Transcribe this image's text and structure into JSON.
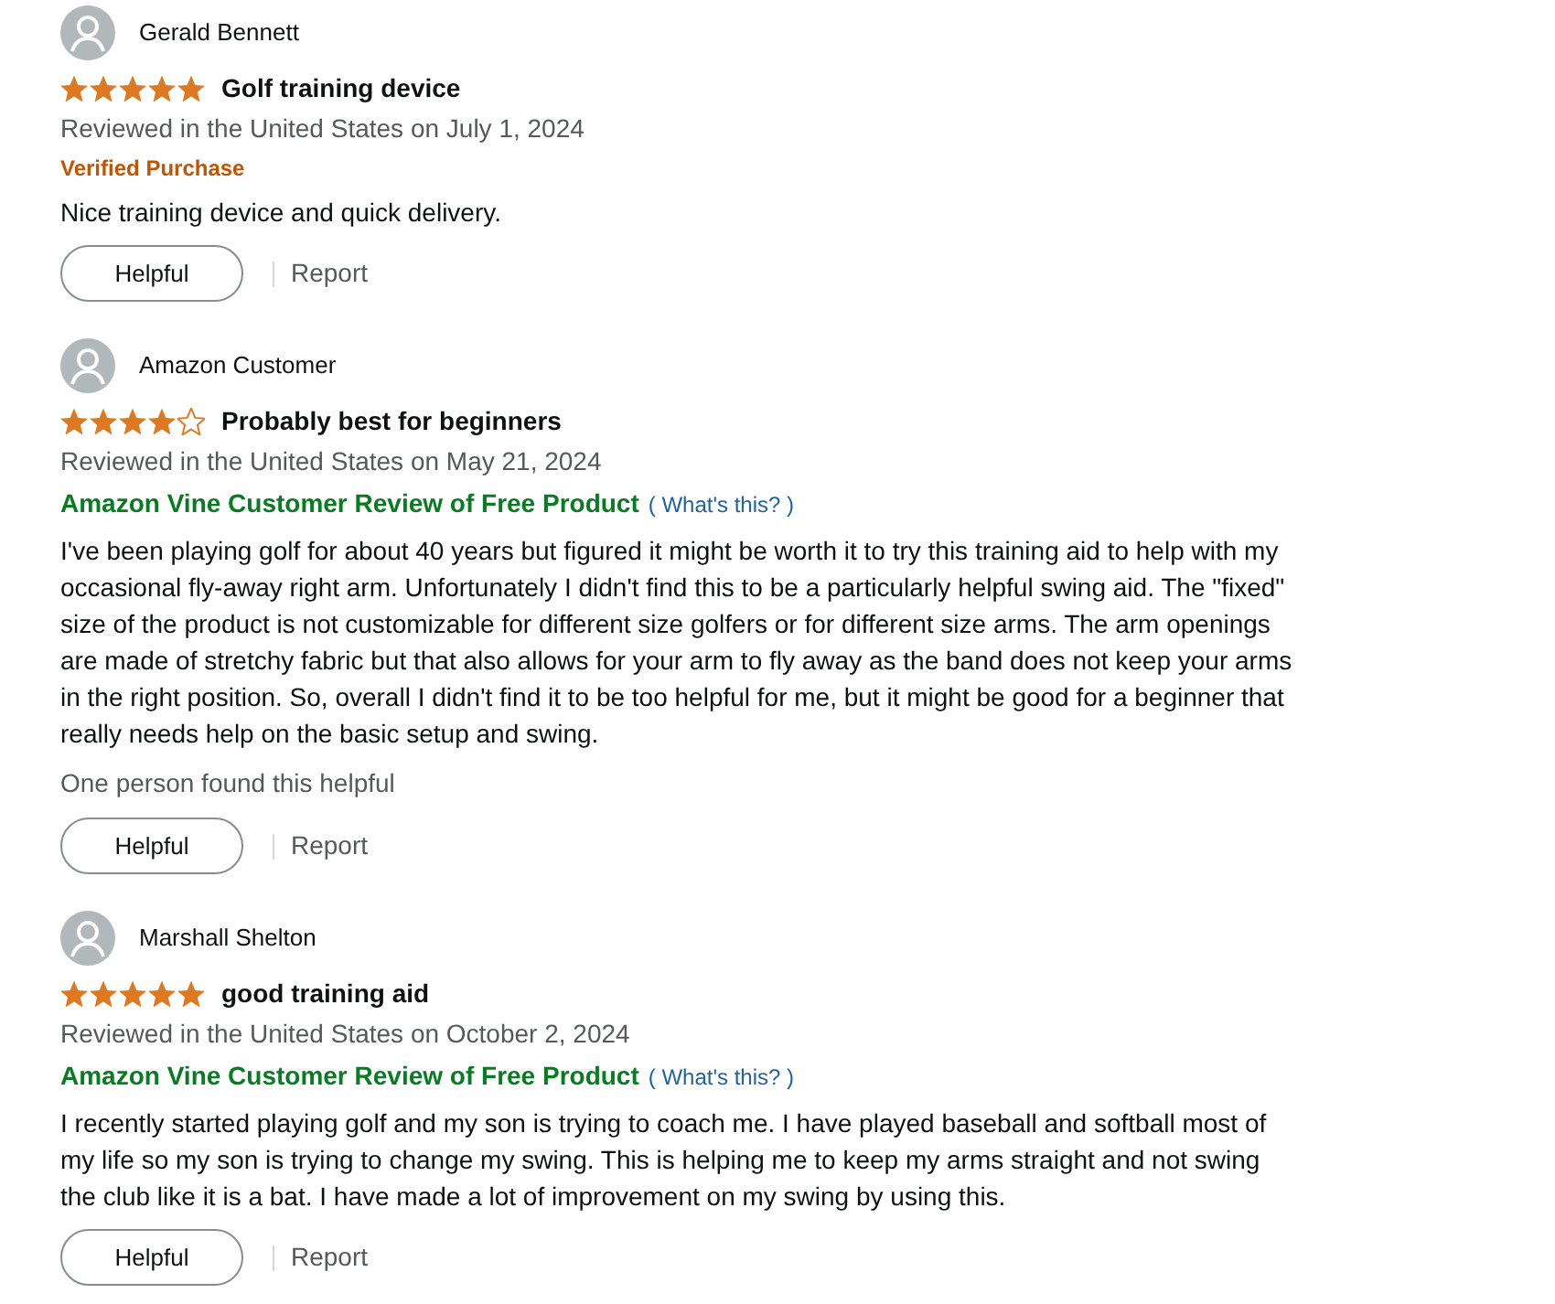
{
  "reviews": [
    {
      "author": "Gerald Bennett",
      "stars": 5,
      "title": "Golf training device",
      "date": "Reviewed in the United States on July 1, 2024",
      "badge": {
        "kind": "verified",
        "text": "Verified Purchase"
      },
      "body": "Nice training device and quick delivery.",
      "helpful_button": "Helpful",
      "report_link": "Report"
    },
    {
      "author": "Amazon Customer",
      "stars": 4,
      "title": "Probably best for beginners",
      "date": "Reviewed in the United States on May 21, 2024",
      "badge": {
        "kind": "vine",
        "text": "Amazon Vine Customer Review of Free Product",
        "link": "( What's this? )"
      },
      "body": "I've been playing golf for about 40 years but figured it might be worth it to try this training aid to help with my occasional fly-away right arm. Unfortunately I didn't find this to be a particularly helpful swing aid. The \"fixed\" size of the product is not customizable for different size golfers or for different size arms. The arm openings are made of stretchy fabric but that also allows for your arm to fly away as the band does not keep your arms in the right position. So, overall I didn't find it to be too helpful for me, but it might be good for a beginner that really needs help on the basic setup and swing.",
      "helpful_count": "One person found this helpful",
      "helpful_button": "Helpful",
      "report_link": "Report"
    },
    {
      "author": "Marshall Shelton",
      "stars": 5,
      "title": "good training aid",
      "date": "Reviewed in the United States on October 2, 2024",
      "badge": {
        "kind": "vine",
        "text": "Amazon Vine Customer Review of Free Product",
        "link": "( What's this? )"
      },
      "body": "I recently started playing golf and my son is trying to coach me. I have played baseball and softball most of my life so my son is trying to change my swing. This is helping me to keep my arms straight and not swing the club like it is a bat. I have made a lot of improvement on my swing by using this.",
      "helpful_button": "Helpful",
      "report_link": "Report"
    }
  ]
}
